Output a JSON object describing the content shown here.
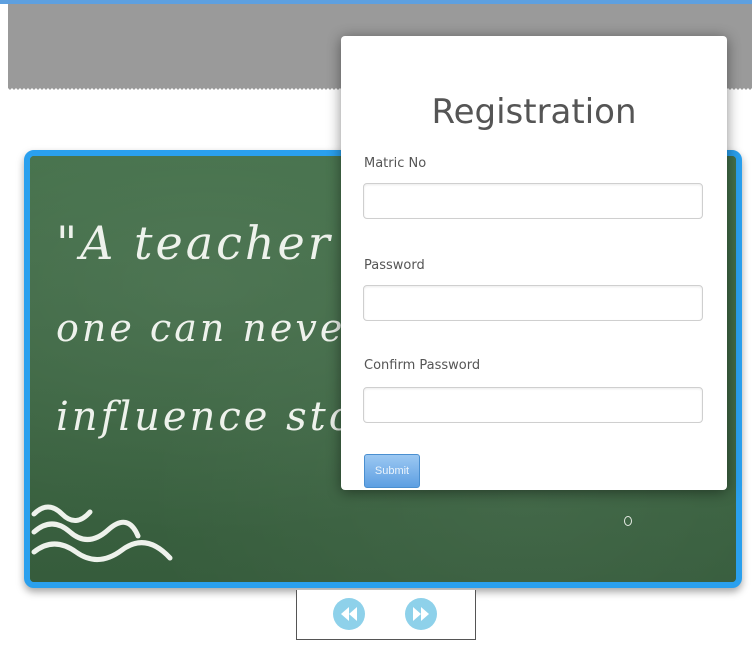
{
  "registration": {
    "title": "Registration",
    "matric_label": "Matric No",
    "matric_value": "",
    "password_label": "Password",
    "password_value": "",
    "confirm_label": "Confirm Password",
    "confirm_value": "",
    "submit_label": "Submit"
  },
  "slide": {
    "quote_line_1": "\"A teacher",
    "quote_line_2": "one can never",
    "quote_line_3": "influence stop"
  },
  "slider_nav": {
    "prev_icon": "rewind-icon",
    "next_icon": "fast-forward-icon"
  },
  "colors": {
    "accent_blue": "#2aa0ee",
    "header_gray": "#9a9a9a",
    "chalkboard_green": "#3f6a45",
    "nav_button": "#8ed1ea",
    "submit_blue": "#5d9fe2"
  }
}
